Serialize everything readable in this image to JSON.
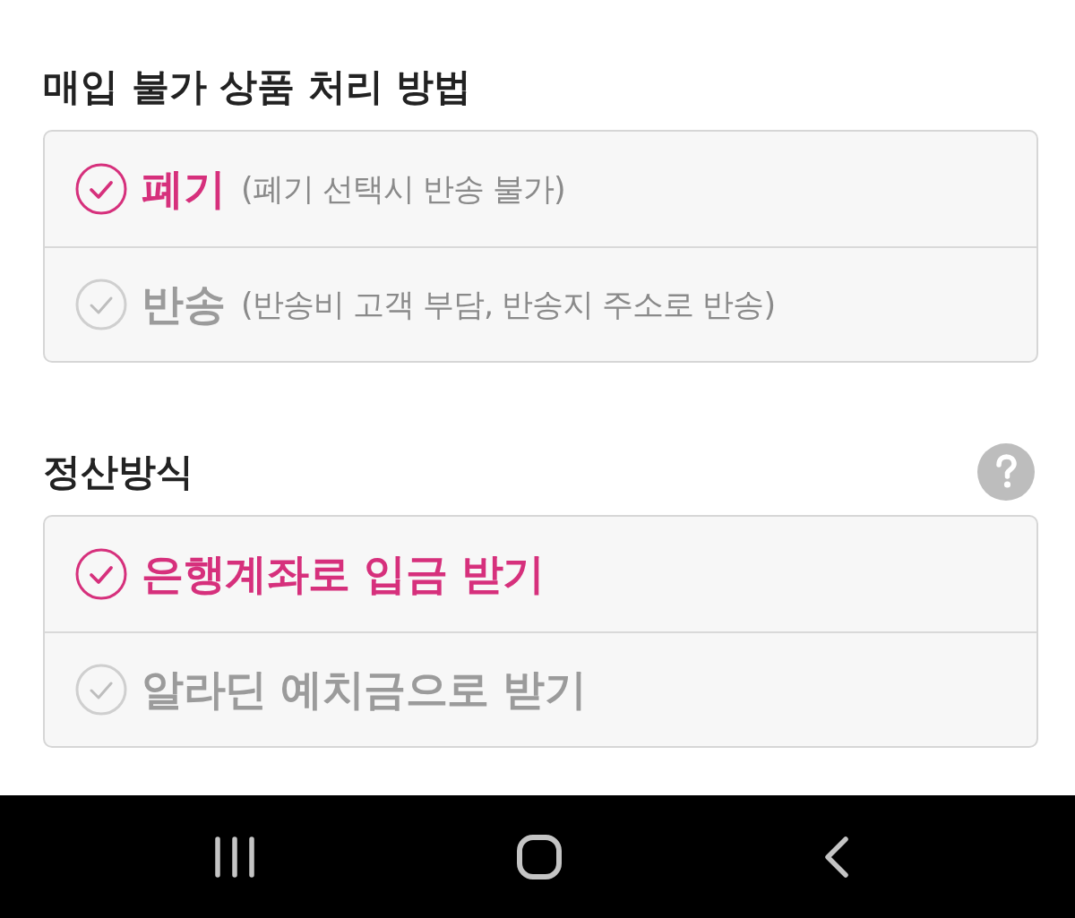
{
  "sections": [
    {
      "title": "매입 불가 상품 처리 방법",
      "options": [
        {
          "label": "폐기",
          "note": "(폐기 선택시 반송 불가)",
          "selected": true
        },
        {
          "label": "반송",
          "note": "(반송비 고객 부담, 반송지 주소로 반송)",
          "selected": false
        }
      ]
    },
    {
      "title": "정산방식",
      "help": true,
      "options": [
        {
          "label": "은행계좌로 입금 받기",
          "selected": true
        },
        {
          "label": "알라딘 예치금으로 받기",
          "selected": false
        }
      ]
    }
  ],
  "nav_bar": {
    "buttons": [
      {
        "kind": "recent"
      },
      {
        "kind": "home"
      },
      {
        "kind": "back"
      }
    ]
  }
}
